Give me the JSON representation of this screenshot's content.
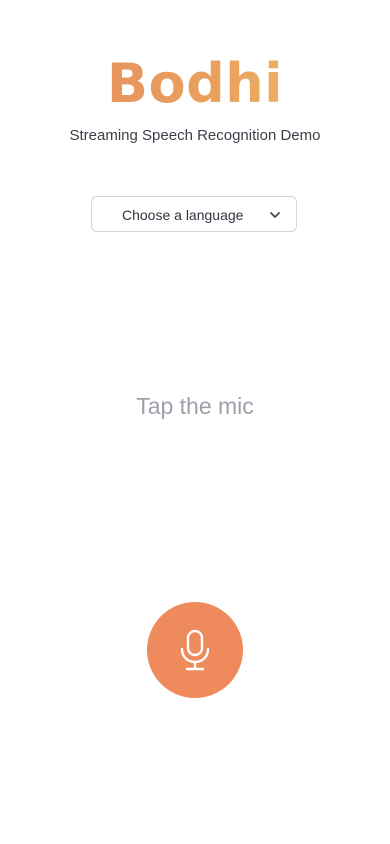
{
  "header": {
    "logo_text": "Bodhi",
    "subtitle": "Streaming Speech Recognition Demo"
  },
  "language_select": {
    "selected": "Choose a language",
    "icon": "chevron-down-icon"
  },
  "main": {
    "prompt": "Tap the mic"
  },
  "mic": {
    "icon": "microphone-icon",
    "color": "#ef8a5c"
  },
  "colors": {
    "logo_gradient_start": "#e98a64",
    "logo_gradient_end": "#f3c46e",
    "accent": "#ef8a5c"
  }
}
